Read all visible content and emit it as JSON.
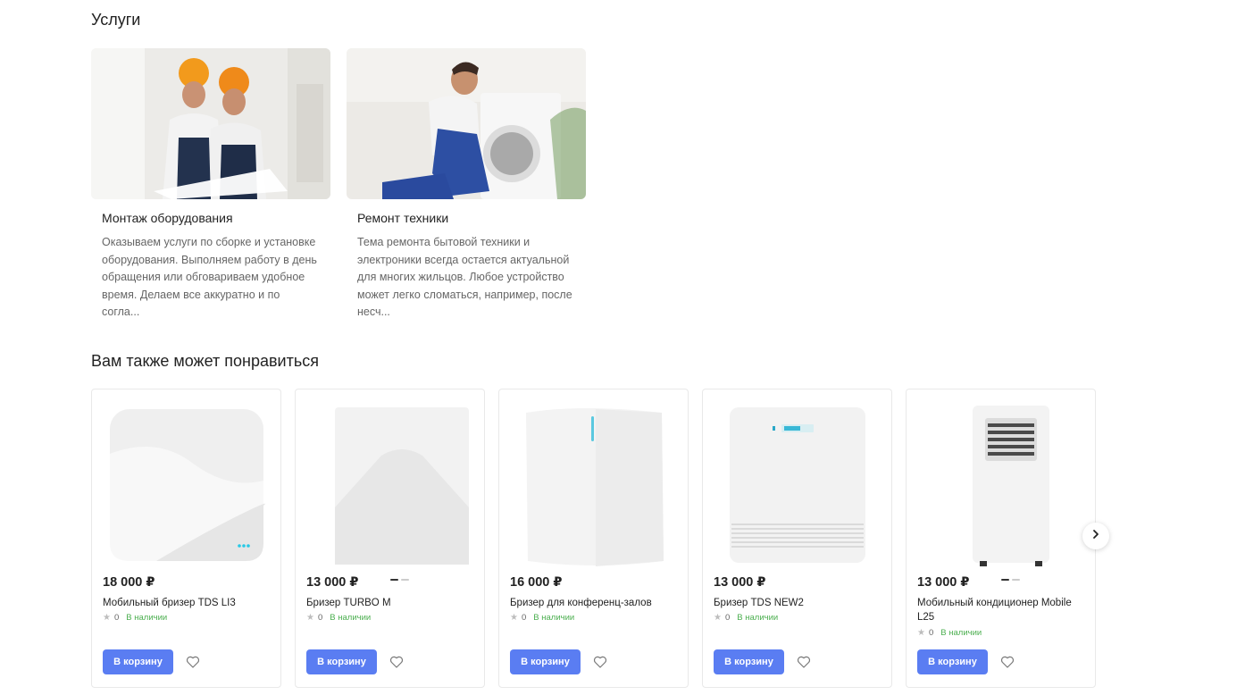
{
  "services": {
    "title": "Услуги",
    "items": [
      {
        "name": "Монтаж оборудования",
        "description": "Оказываем услуги по сборке и установке оборудования. Выполняем работу в день обращения или обговариваем удобное время. Делаем все аккуратно и по согла..."
      },
      {
        "name": "Ремонт техники",
        "description": "Тема ремонта бытовой техники и электроники всегда остается актуальной для многих жильцов. Любое устройство может легко сломаться, например, после несч..."
      }
    ]
  },
  "recommendations": {
    "title": "Вам также может понравиться",
    "cart_label": "В корзину",
    "products": [
      {
        "price": "18 000 ₽",
        "name": "Мобильный бризер TDS LI3",
        "rating": "0",
        "stock": "В наличии"
      },
      {
        "price": "13 000 ₽",
        "name": "Бризер TURBO M",
        "rating": "0",
        "stock": "В наличии"
      },
      {
        "price": "16 000 ₽",
        "name": "Бризер для конференц-залов",
        "rating": "0",
        "stock": "В наличии"
      },
      {
        "price": "13 000 ₽",
        "name": "Бризер TDS NEW2",
        "rating": "0",
        "stock": "В наличии"
      },
      {
        "price": "13 000 ₽",
        "name": "Мобильный кондиционер Mobile L25",
        "rating": "0",
        "stock": "В наличии"
      }
    ]
  },
  "colors": {
    "accent": "#5a7df2",
    "in_stock": "#4caf50"
  },
  "icons": {
    "rating": "star-icon",
    "favorite": "heart-icon",
    "next": "chevron-right-icon"
  }
}
